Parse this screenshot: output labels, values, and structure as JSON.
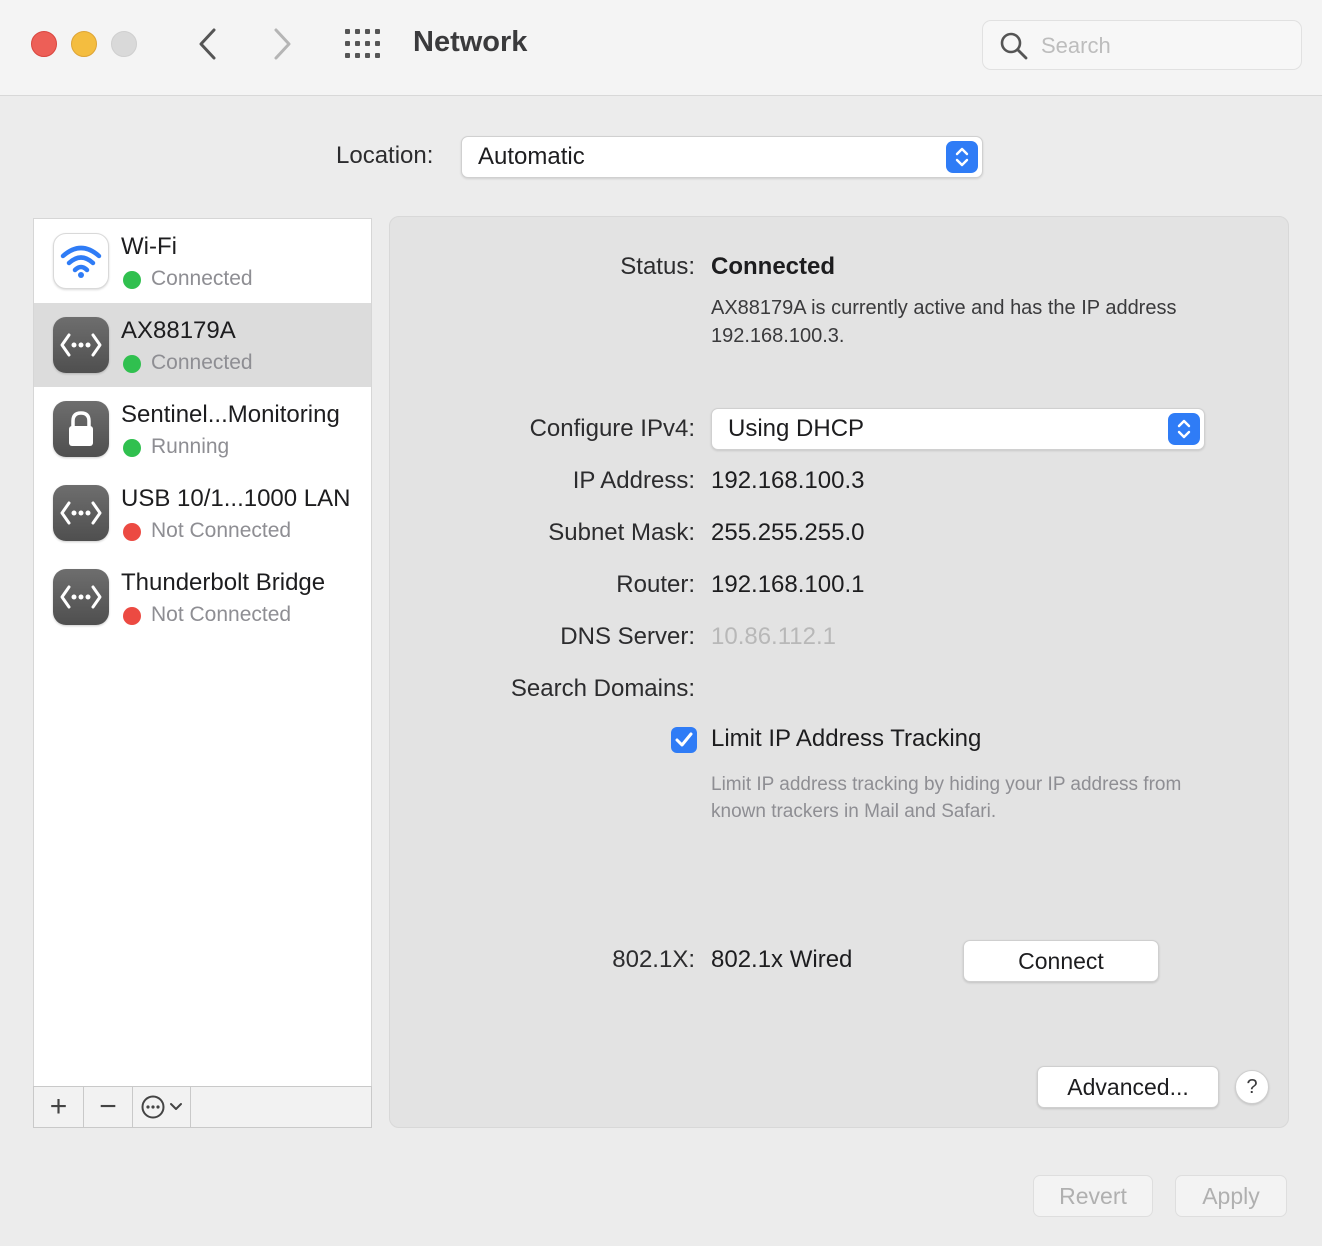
{
  "window": {
    "title": "Network",
    "search_placeholder": "Search"
  },
  "location": {
    "label": "Location:",
    "value": "Automatic"
  },
  "services": [
    {
      "name": "Wi-Fi",
      "status": "Connected",
      "status_color": "#30c04f",
      "icon": "wifi-icon"
    },
    {
      "name": "AX88179A",
      "status": "Connected",
      "status_color": "#30c04f",
      "icon": "ethernet-icon"
    },
    {
      "name": "Sentinel...Monitoring",
      "status": "Running",
      "status_color": "#30c04f",
      "icon": "lock-icon"
    },
    {
      "name": "USB 10/1...1000 LAN",
      "status": "Not Connected",
      "status_color": "#ec4a42",
      "icon": "ethernet-icon"
    },
    {
      "name": "Thunderbolt Bridge",
      "status": "Not Connected",
      "status_color": "#ec4a42",
      "icon": "ethernet-icon"
    }
  ],
  "sidebar_controls": {
    "add": "+",
    "remove": "−"
  },
  "detail": {
    "status_label": "Status:",
    "status_value": "Connected",
    "status_description": "AX88179A is currently active and has the IP address 192.168.100.3.",
    "configure_label": "Configure IPv4:",
    "configure_value": "Using DHCP",
    "ip_label": "IP Address:",
    "ip_value": "192.168.100.3",
    "subnet_label": "Subnet Mask:",
    "subnet_value": "255.255.255.0",
    "router_label": "Router:",
    "router_value": "192.168.100.1",
    "dns_label": "DNS Server:",
    "dns_value": "10.86.112.1",
    "search_domains_label": "Search Domains:",
    "limit_tracking_label": "Limit IP Address Tracking",
    "limit_tracking_checked": true,
    "limit_tracking_description": "Limit IP address tracking by hiding your IP address from known trackers in Mail and Safari.",
    "dot1x_label": "802.1X:",
    "dot1x_value": "802.1x Wired",
    "connect_button": "Connect",
    "advanced_button": "Advanced...",
    "help_button": "?"
  },
  "footer": {
    "revert_button": "Revert",
    "apply_button": "Apply"
  },
  "colors": {
    "accent": "#2f7cf6",
    "connected": "#30c04f",
    "not_connected": "#ec4a42"
  }
}
